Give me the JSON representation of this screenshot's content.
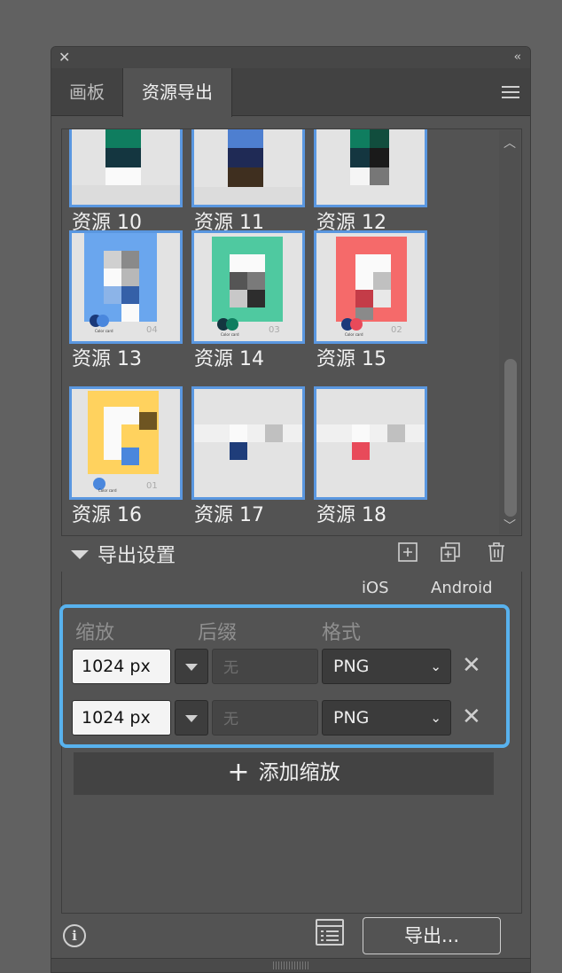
{
  "panel": {
    "close_glyph": "✕",
    "collapse_glyph": "‹‹",
    "tabs": [
      {
        "label": "画板",
        "active": false
      },
      {
        "label": "资源导出",
        "active": true
      }
    ]
  },
  "assets": [
    {
      "label": "资源 10"
    },
    {
      "label": "资源 11"
    },
    {
      "label": "资源 12"
    },
    {
      "label": "资源 13",
      "caption": "04"
    },
    {
      "label": "资源 14",
      "caption": "03"
    },
    {
      "label": "资源 15",
      "caption": "02"
    },
    {
      "label": "资源 16",
      "caption": "01"
    },
    {
      "label": "资源 17"
    },
    {
      "label": "资源 18"
    }
  ],
  "color_card_text": "Color card",
  "export_settings": {
    "title": "导出设置",
    "platforms": {
      "ios": "iOS",
      "android": "Android"
    },
    "columns": {
      "scale": "缩放",
      "suffix": "后缀",
      "format": "格式"
    },
    "rows": [
      {
        "size": "1024 px",
        "suffix_placeholder": "无",
        "format": "PNG"
      },
      {
        "size": "1024 px",
        "suffix_placeholder": "无",
        "format": "PNG"
      }
    ],
    "add_scale": "添加缩放",
    "export_button": "导出..."
  },
  "colors": {
    "accent_blue": "#58b2ee",
    "frame_blue": "#5a97e0",
    "green": "#4fc9a0",
    "red": "#f56a6a",
    "yellow": "#ffd25e",
    "blue": "#6aa6ee"
  },
  "icons": [
    "close-icon",
    "collapse-icon",
    "menu-icon",
    "disclosure-triangle-icon",
    "add-artboard-icon",
    "duplicate-icon",
    "trash-icon",
    "dropdown-arrow-icon",
    "chevron-down-icon",
    "remove-icon",
    "plus-icon",
    "info-icon",
    "list-icon",
    "scroll-up-icon",
    "scroll-down-icon"
  ]
}
